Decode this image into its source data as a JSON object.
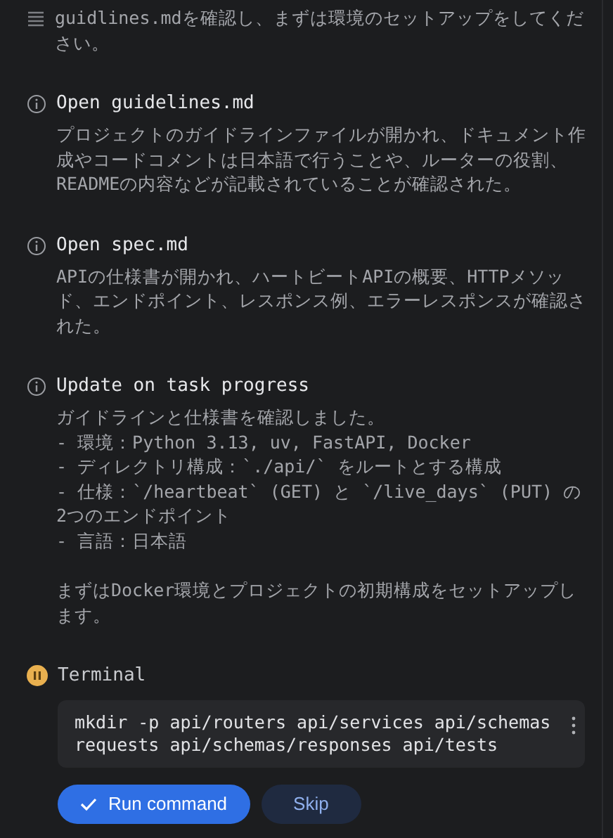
{
  "steps": [
    {
      "kind": "message",
      "body": "guidlines.mdを確認し、まずは環境のセットアップをしてください。"
    },
    {
      "kind": "info",
      "title": "Open guidelines.md",
      "body": "プロジェクトのガイドラインファイルが開かれ、ドキュメント作成やコードコメントは日本語で行うことや、ルーターの役割、READMEの内容などが記載されていることが確認された。"
    },
    {
      "kind": "info",
      "title": "Open spec.md",
      "body": "APIの仕様書が開かれ、ハートビートAPIの概要、HTTPメソッド、エンドポイント、レスポンス例、エラーレスポンスが確認された。"
    },
    {
      "kind": "info",
      "title": "Update on task progress",
      "body": "ガイドラインと仕様書を確認しました。\n- 環境：Python 3.13, uv, FastAPI, Docker\n- ディレクトリ構成：`./api/` をルートとする構成\n- 仕様：`/heartbeat` (GET) と `/live_days` (PUT) の2つのエンドポイント\n- 言語：日本語",
      "note": "まずはDocker環境とプロジェクトの初期構成をセットアップします。"
    },
    {
      "kind": "terminal",
      "title": "Terminal",
      "command": "mkdir -p api/routers api/services api/schemas requests api/schemas/responses api/tests",
      "buttons": [
        {
          "kind": "primary",
          "label": "Run command"
        },
        {
          "kind": "secondary",
          "label": "Skip"
        }
      ]
    }
  ]
}
